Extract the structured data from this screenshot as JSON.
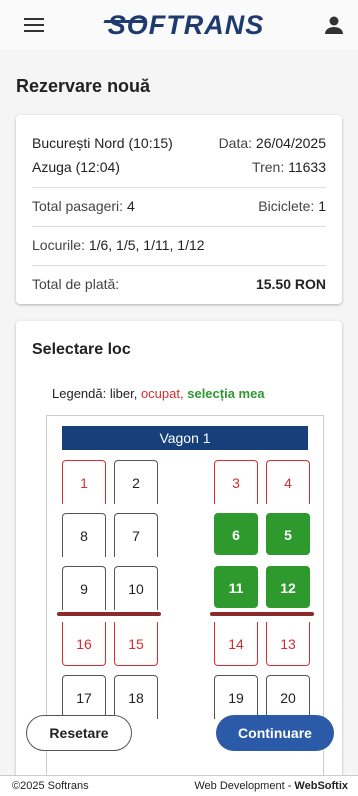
{
  "header": {
    "logo_text": "SOFTRANS",
    "menu_icon": "menu-icon",
    "account_icon": "account-icon"
  },
  "page": {
    "title": "Rezervare nouă"
  },
  "summary": {
    "departure": "București Nord (10:15)",
    "date_label": "Data:",
    "date_value": "26/04/2025",
    "arrival": "Azuga (12:04)",
    "train_label": "Tren:",
    "train_value": "11633",
    "passengers_label": "Total pasageri:",
    "passengers_value": "4",
    "bikes_label": "Biciclete:",
    "bikes_value": "1",
    "seats_label": "Locurile:",
    "seats_value": "1/6, 1/5, 1/11, 1/12",
    "total_label": "Total de plată:",
    "total_value": "15.50 RON"
  },
  "seat_selection": {
    "title": "Selectare loc",
    "legend_prefix": "Legendă:",
    "legend_free": "liber,",
    "legend_occupied": "ocupat,",
    "legend_mine": "selecția mea",
    "wagon_label": "Vagon 1",
    "seats": [
      {
        "n": "1",
        "state": "occupied"
      },
      {
        "n": "2",
        "state": "free"
      },
      {
        "n": "3",
        "state": "occupied"
      },
      {
        "n": "4",
        "state": "occupied"
      },
      {
        "n": "8",
        "state": "free"
      },
      {
        "n": "7",
        "state": "free"
      },
      {
        "n": "6",
        "state": "selected"
      },
      {
        "n": "5",
        "state": "selected"
      },
      {
        "n": "9",
        "state": "free"
      },
      {
        "n": "10",
        "state": "free"
      },
      {
        "n": "11",
        "state": "selected"
      },
      {
        "n": "12",
        "state": "selected"
      },
      {
        "n": "16",
        "state": "occupied"
      },
      {
        "n": "15",
        "state": "occupied"
      },
      {
        "n": "14",
        "state": "occupied"
      },
      {
        "n": "13",
        "state": "occupied"
      },
      {
        "n": "17",
        "state": "free"
      },
      {
        "n": "18",
        "state": "free"
      },
      {
        "n": "19",
        "state": "free"
      },
      {
        "n": "20",
        "state": "free"
      }
    ]
  },
  "actions": {
    "reset_label": "Resetare",
    "continue_label": "Continuare"
  },
  "footer": {
    "copyright": "©2025 Softrans",
    "credit_prefix": "Web Development -",
    "credit_name": "WebSoftix"
  },
  "colors": {
    "primary": "#173f7a",
    "button": "#2b5aa8",
    "occupied": "#d32f2f",
    "selected": "#2e9a2e",
    "divider": "#8a2a2a"
  }
}
